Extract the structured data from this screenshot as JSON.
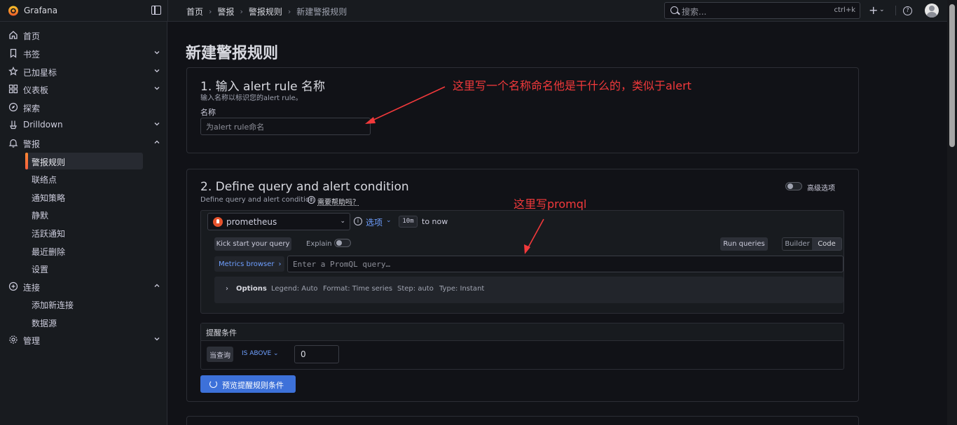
{
  "app": {
    "title": "Grafana"
  },
  "breadcrumb": [
    "首页",
    "警报",
    "警报规则",
    "新建警报规则"
  ],
  "search": {
    "placeholder": "搜索...",
    "shortcut": "ctrl+k"
  },
  "sidebar": {
    "items": [
      {
        "label": "首页",
        "icon": "home-icon"
      },
      {
        "label": "书签",
        "icon": "bookmark-icon"
      },
      {
        "label": "已加星标",
        "icon": "star-icon"
      },
      {
        "label": "仪表板",
        "icon": "dashboard-icon"
      },
      {
        "label": "探索",
        "icon": "compass-icon"
      },
      {
        "label": "Drilldown",
        "icon": "drilldown-icon"
      },
      {
        "label": "警报",
        "icon": "bell-icon"
      },
      {
        "label": "连接",
        "icon": "connection-icon"
      },
      {
        "label": "管理",
        "icon": "gear-icon"
      }
    ],
    "alerting_sub": [
      "警报规则",
      "联络点",
      "通知策略",
      "静默",
      "活跃通知",
      "最近删除",
      "设置"
    ],
    "connections_sub": [
      "添加新连接",
      "数据源"
    ]
  },
  "page": {
    "title": "新建警报规则"
  },
  "section1": {
    "title": "1. 输入 alert rule 名称",
    "desc": "输入名称以标识您的alert rule。",
    "name_label": "名称",
    "name_placeholder": "为alert rule命名",
    "annotation": "这里写一个名称命名他是干什么的，类似于alert"
  },
  "section2": {
    "title": "2. Define query and alert condition",
    "desc": "Define query and alert condition",
    "help_link": "需要帮助吗？",
    "advanced_toggle": "高级选项",
    "annotation": "这里写promql",
    "datasource": "prometheus",
    "options_link": "选项",
    "time_range": "10m",
    "time_to": "to now",
    "kick_start": "Kick start your query",
    "explain": "Explain",
    "run_queries": "Run queries",
    "builder": "Builder",
    "code": "Code",
    "metrics_browser": "Metrics browser",
    "promql_placeholder": "Enter a PromQL query…",
    "options": {
      "label": "Options",
      "legend": "Legend: Auto",
      "format": "Format: Time series",
      "step": "Step: auto",
      "type": "Type: Instant"
    },
    "condition": {
      "title": "提醒条件",
      "query": "当查询",
      "operator": "IS ABOVE",
      "value": "0"
    },
    "preview_button": "预览提醒规则条件"
  },
  "colors": {
    "accent": "#f55f3e",
    "primary": "#3d71d9",
    "annotation": "#f2393b",
    "link": "#6e9fff"
  }
}
